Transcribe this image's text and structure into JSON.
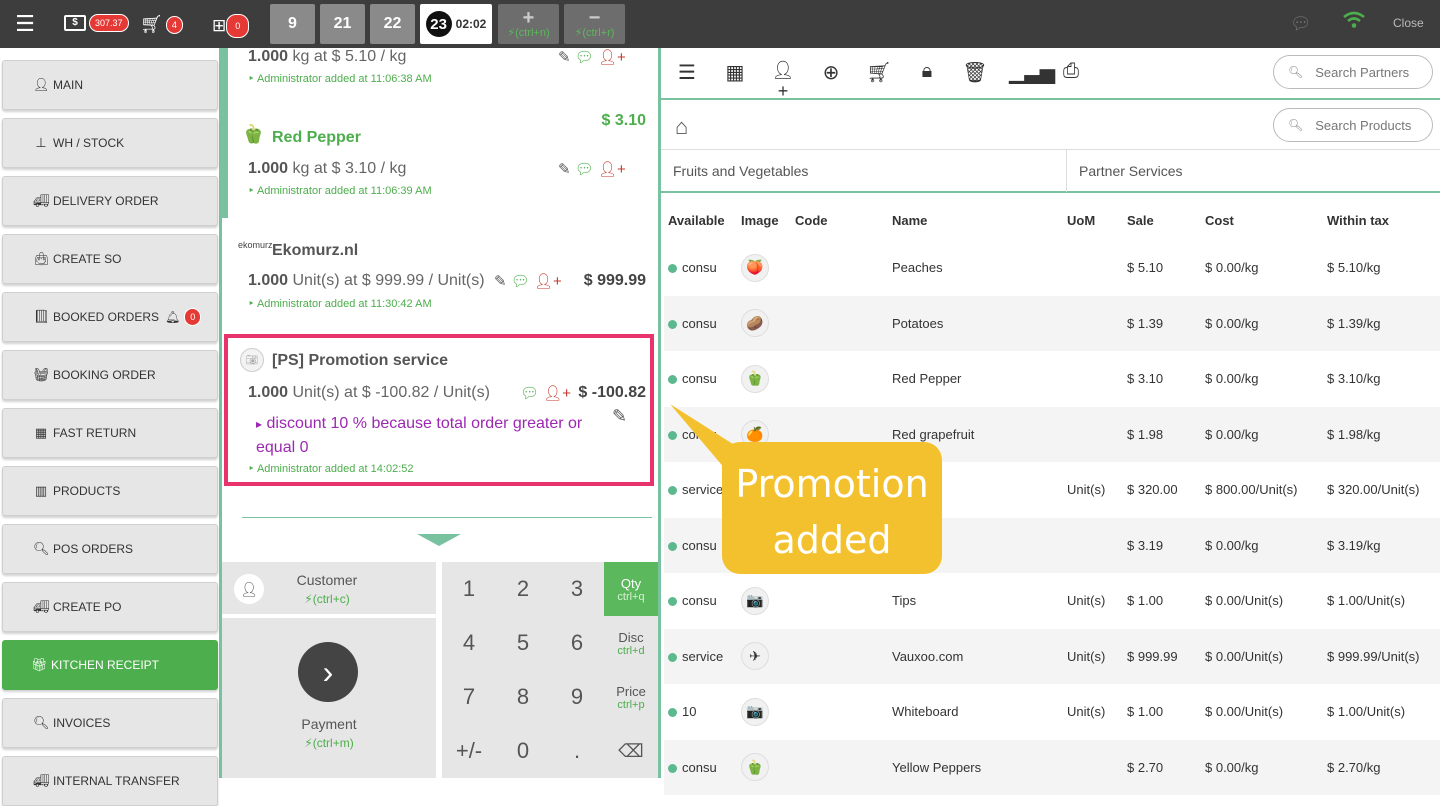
{
  "topbar": {
    "cash_amount": "307.37",
    "cart_count": "4",
    "gift_count": "0",
    "order_tabs": [
      "9",
      "21",
      "22"
    ],
    "active_tab": {
      "num": "23",
      "time": "02:02"
    },
    "add_hint": "(ctrl+n)",
    "remove_hint": "(ctrl+r)",
    "close_label": "Close",
    "icons": {
      "menu": "menu-icon",
      "cash": "cash-icon",
      "cart": "cart-icon",
      "gift": "gift-icon",
      "chat": "chat-icon",
      "wifi": "wifi-icon"
    }
  },
  "sidebar": {
    "items": [
      {
        "label": "MAIN",
        "icon": "user"
      },
      {
        "label": "WH / STOCK",
        "icon": "sitemap"
      },
      {
        "label": "DELIVERY ORDER",
        "icon": "truck"
      },
      {
        "label": "CREATE SO",
        "icon": "bag"
      },
      {
        "label": "BOOKED ORDERS",
        "icon": "book",
        "badge": "0"
      },
      {
        "label": "BOOKING ORDER",
        "icon": "basket"
      },
      {
        "label": "FAST RETURN",
        "icon": "building"
      },
      {
        "label": "PRODUCTS",
        "icon": "barcode"
      },
      {
        "label": "POS ORDERS",
        "icon": "search"
      },
      {
        "label": "CREATE PO",
        "icon": "truck"
      },
      {
        "label": "KITCHEN RECEIPT",
        "icon": "gift"
      },
      {
        "label": "INVOICES",
        "icon": "search"
      },
      {
        "label": "INTERNAL TRANSFER",
        "icon": "truck"
      }
    ]
  },
  "order_lines": [
    {
      "qty": "1.000",
      "qty_text": "kg at $ 5.10 / kg",
      "meta": "Administrator added at 11:06:38 AM"
    },
    {
      "name": "Red Pepper",
      "price": "$ 3.10",
      "qty": "1.000",
      "qty_text": "kg at $ 3.10 / kg",
      "meta": "Administrator added at 11:06:39 AM"
    },
    {
      "logo": "ekomurz",
      "name": "Ekomurz.nl",
      "price": "$ 999.99",
      "qty": "1.000",
      "qty_text": "Unit(s) at $ 999.99 / Unit(s)",
      "meta": "Administrator added at 11:30:42 AM"
    },
    {
      "name": "[PS] Promotion service",
      "price": "$ -100.82",
      "qty": "1.000",
      "qty_text": "Unit(s) at $ -100.82 / Unit(s)",
      "note": "discount 10 % because total order greater or equal 0",
      "meta": "Administrator added at 14:02:52"
    }
  ],
  "keypad": {
    "customer_label": "Customer",
    "customer_hint": "(ctrl+c)",
    "payment_label": "Payment",
    "payment_hint": "(ctrl+m)",
    "keys": [
      "1",
      "2",
      "3",
      "4",
      "5",
      "6",
      "7",
      "8",
      "9",
      "+/-",
      "0",
      "."
    ],
    "functions": [
      {
        "label": "Qty",
        "hint": "ctrl+q"
      },
      {
        "label": "Disc",
        "hint": "ctrl+d"
      },
      {
        "label": "Price",
        "hint": "ctrl+p"
      }
    ]
  },
  "right": {
    "search_partners": "Search Partners",
    "search_products": "Search Products",
    "categories": [
      "Fruits and Vegetables",
      "Partner Services"
    ],
    "columns": [
      "Available",
      "Image",
      "Code",
      "Name",
      "UoM",
      "Sale",
      "Cost",
      "Within tax"
    ],
    "products": [
      {
        "available": "consu",
        "name": "Peaches",
        "uom": "",
        "sale": "$ 5.10",
        "cost": "$ 0.00/kg",
        "tax": "$ 5.10/kg",
        "img": "🍑"
      },
      {
        "available": "consu",
        "name": "Potatoes",
        "uom": "",
        "sale": "$ 1.39",
        "cost": "$ 0.00/kg",
        "tax": "$ 1.39/kg",
        "img": "🥔"
      },
      {
        "available": "consu",
        "name": "Red Pepper",
        "uom": "",
        "sale": "$ 3.10",
        "cost": "$ 0.00/kg",
        "tax": "$ 3.10/kg",
        "img": "🫑"
      },
      {
        "available": "consu",
        "name": "Red grapefruit",
        "uom": "",
        "sale": "$ 1.98",
        "cost": "$ 0.00/kg",
        "tax": "$ 1.98/kg",
        "img": "🍊"
      },
      {
        "available": "service",
        "name": "",
        "uom": "Unit(s)",
        "sale": "$ 320.00",
        "cost": "$ 800.00/Unit(s)",
        "tax": "$ 320.00/Unit(s)",
        "img": ""
      },
      {
        "available": "consu",
        "name": "",
        "uom": "",
        "sale": "$ 3.19",
        "cost": "$ 0.00/kg",
        "tax": "$ 3.19/kg",
        "img": ""
      },
      {
        "available": "consu",
        "name": "Tips",
        "uom": "Unit(s)",
        "sale": "$ 1.00",
        "cost": "$ 0.00/Unit(s)",
        "tax": "$ 1.00/Unit(s)",
        "img": "📷"
      },
      {
        "available": "service",
        "name": "Vauxoo.com",
        "uom": "Unit(s)",
        "sale": "$ 999.99",
        "cost": "$ 0.00/Unit(s)",
        "tax": "$ 999.99/Unit(s)",
        "img": "✈"
      },
      {
        "available": "10",
        "name": "Whiteboard",
        "uom": "Unit(s)",
        "sale": "$ 1.00",
        "cost": "$ 0.00/Unit(s)",
        "tax": "$ 1.00/Unit(s)",
        "img": "📷"
      },
      {
        "available": "consu",
        "name": "Yellow Peppers",
        "uom": "",
        "sale": "$ 2.70",
        "cost": "$ 0.00/kg",
        "tax": "$ 2.70/kg",
        "img": "🫑"
      }
    ]
  },
  "callout": {
    "line1": "Promotion",
    "line2": "added"
  },
  "colors": {
    "accent": "#78c2a0",
    "green": "#4cae4c",
    "highlight": "#e8336d",
    "callout": "#f4c12e",
    "badge": "#e53935"
  }
}
